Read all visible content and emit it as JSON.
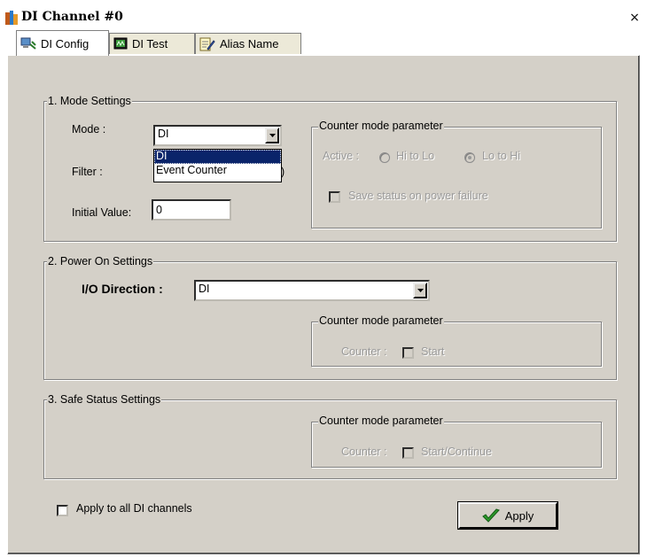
{
  "window": {
    "title": "DI Channel #0",
    "close_glyph": "×"
  },
  "tabs": [
    {
      "label": "DI Config",
      "icon": "network-config-icon",
      "active": true
    },
    {
      "label": "DI Test",
      "icon": "monitor-test-icon",
      "active": false
    },
    {
      "label": "Alias Name",
      "icon": "notepad-pencil-icon",
      "active": false
    }
  ],
  "mode_settings": {
    "legend": "1. Mode Settings",
    "mode_label": "Mode :",
    "mode_value": "DI",
    "mode_options": [
      "DI",
      "Event Counter"
    ],
    "filter_label": "Filter :",
    "filter_value_partial": ")",
    "initial_label": "Initial Value:",
    "initial_value": "0",
    "counter": {
      "legend": "Counter mode parameter",
      "active_label": "Active :",
      "option_hi_lo": "Hi to Lo",
      "option_lo_hi": "Lo to Hi",
      "selected": "Lo to Hi",
      "save_status_label": "Save status on power failure"
    }
  },
  "power_on": {
    "legend": "2. Power On Settings",
    "direction_label": "I/O Direction :",
    "direction_value": "DI",
    "counter": {
      "legend": "Counter mode parameter",
      "label": "Counter :",
      "checkbox_label": "Start"
    }
  },
  "safe_status": {
    "legend": "3. Safe Status Settings",
    "counter": {
      "legend": "Counter mode parameter",
      "label": "Counter :",
      "checkbox_label": "Start/Continue"
    }
  },
  "footer": {
    "apply_all_label": "Apply to all DI channels",
    "apply_button": "Apply"
  }
}
